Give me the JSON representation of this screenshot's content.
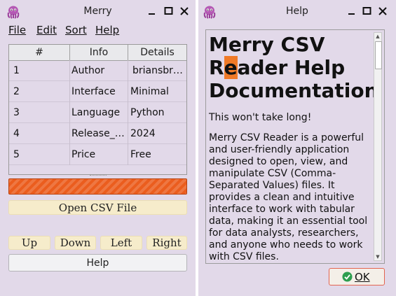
{
  "main_window": {
    "title": "Merry",
    "menu": [
      "File",
      "Edit",
      "Sort",
      "Help"
    ],
    "table": {
      "columns": [
        "#",
        "Info",
        "Details"
      ],
      "rows": [
        [
          "1",
          "Author",
          "briansbr…"
        ],
        [
          "2",
          "Interface",
          "Minimal"
        ],
        [
          "3",
          "Language",
          "Python"
        ],
        [
          "4",
          "Release_…",
          "2024"
        ],
        [
          "5",
          "Price",
          "Free"
        ]
      ]
    },
    "progress": 1.0,
    "open_csv_label": "Open CSV File",
    "nav_buttons": [
      "Up",
      "Down",
      "Left",
      "Right"
    ],
    "help_button_label": "Help"
  },
  "help_window": {
    "title": "Help",
    "heading_part1": "Merry CSV",
    "heading_pre": "R",
    "heading_cursor": "e",
    "heading_post": "ader Help",
    "heading_part3": "Documentation",
    "intro": "This won't take long!",
    "body": "Merry CSV Reader is a powerful and user-friendly application designed to open, view, and manipulate CSV (Comma-Separated Values) files. It provides a clean and intuitive interface to work with tabular data, making it an essential tool for data analysts, researchers, and anyone who needs to work with CSV files.",
    "ok_label": "OK"
  },
  "colors": {
    "window_bg": "#e2d9e9",
    "progress": "#eb5d1e",
    "cream_button": "#f6eccb",
    "ok_border": "#e3644f",
    "ok_check": "#2e9e4f"
  },
  "icons": [
    "octopus-app-icon",
    "minimize-icon",
    "maximize-icon",
    "close-icon",
    "checkmark-icon"
  ]
}
